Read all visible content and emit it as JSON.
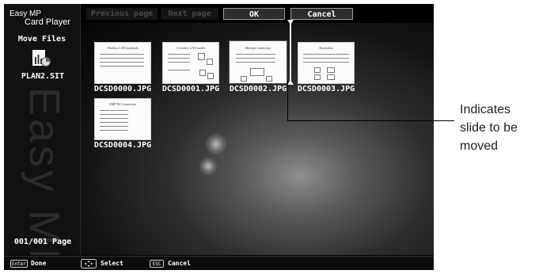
{
  "app": {
    "brand_line1": "Easy MP",
    "brand_line2": "Card Player",
    "watermark": "Easy MP"
  },
  "toolbar": {
    "previous_label": "Previous page",
    "next_label": "Next page",
    "ok_label": "OK",
    "cancel_label": "Cancel"
  },
  "sidebar": {
    "mode_label": "Move Files",
    "file_icon": "scenario-file-icon",
    "file_name": "PLAN2.SIT",
    "page_count": "001/001 Page"
  },
  "thumbnails": [
    {
      "name": "DCSD0000.JPG",
      "title": "Wireless LAN standards"
    },
    {
      "name": "DCSD0001.JPG",
      "title": "2 wireless LAN modes"
    },
    {
      "name": "DCSD0002.JPG",
      "title": "Multiple connection"
    },
    {
      "name": "DCSD0003.JPG",
      "title": "Resolution"
    },
    {
      "name": "DCSD0004.JPG",
      "title": "EMP NS Connection"
    }
  ],
  "statusbar": {
    "enter_key": "Enter",
    "enter_label": "Done",
    "arrow_key": "arrows-icon",
    "arrow_label": "Select",
    "esc_key": "ESC",
    "esc_label": "Cancel"
  },
  "callout": {
    "line1": "Indicates",
    "line2": "slide to be",
    "line3": "moved"
  },
  "colors": {
    "screen_bg": "#000000",
    "text": "#ffffff",
    "disabled_text": "#4a4a4a"
  }
}
